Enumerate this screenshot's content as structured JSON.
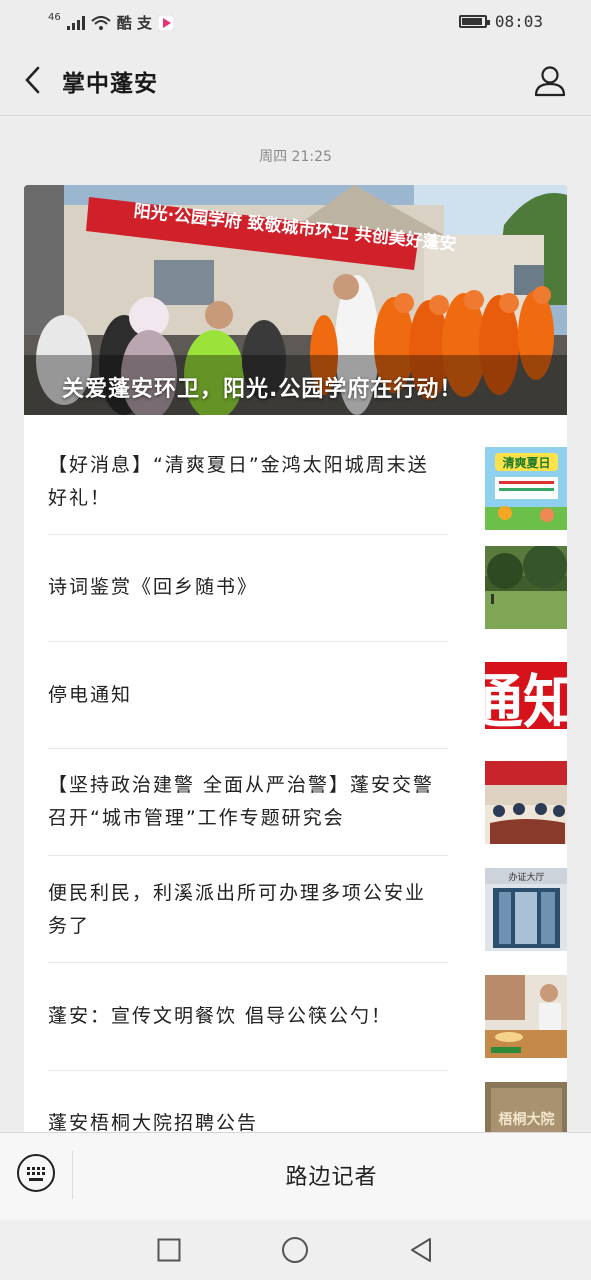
{
  "status": {
    "signal_text": "46",
    "apps": "酷 支",
    "time": "08:03"
  },
  "header": {
    "title": "掌中蓬安",
    "back_icon": "chevron-left-icon",
    "profile_icon": "person-icon"
  },
  "message": {
    "time": "周四 21:25",
    "hero_caption": "关爱蓬安环卫，阳光.公园学府在行动！",
    "hero_banner": "阳光·公园学府 致敬城市环卫 共创美好蓬安",
    "items": [
      {
        "title": "【好消息】“清爽夏日”金鸿太阳城周末送好礼！"
      },
      {
        "title": " 诗词鉴赏《回乡随书》"
      },
      {
        "title": "停电通知"
      },
      {
        "title": " 【坚持政治建警 全面从严治警】蓬安交警召开“城市管理”工作专题研究会"
      },
      {
        "title": "便民利民，利溪派出所可办理多项公安业务了"
      },
      {
        "title": " 蓬安：宣传文明餐饮 倡导公筷公勺！"
      },
      {
        "title": " 蓬安梧桐大院招聘公告"
      }
    ],
    "thumb_texts": {
      "summer": "清爽夏日",
      "notice": "通知",
      "hall": "办证大厅",
      "wutong": "梧桐大院"
    }
  },
  "bottom": {
    "keyboard_icon": "keyboard-icon",
    "menu_label": "路边记者"
  },
  "colors": {
    "background": "#ededed",
    "card": "#ffffff",
    "red_banner": "#d0202a",
    "vest_orange": "#f06a10"
  }
}
